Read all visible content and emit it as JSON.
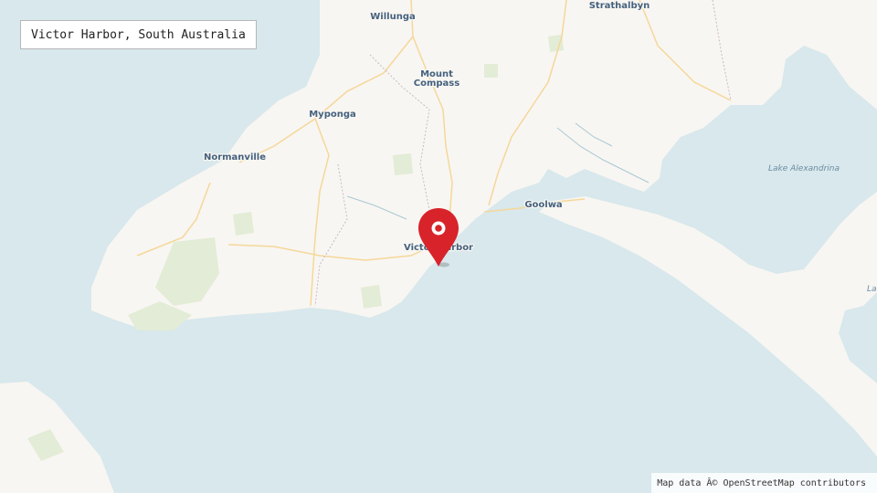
{
  "map": {
    "title": "Victor Harbor, South Australia",
    "attribution": "Map data Â© OpenStreetMap contributors",
    "marker": {
      "label": "Victor Harbor",
      "icon": "map-pin-icon",
      "color": "#d8232a"
    },
    "places": [
      {
        "id": "willunga",
        "name": "Willunga"
      },
      {
        "id": "strathalbyn",
        "name": "Strathalbyn"
      },
      {
        "id": "mount-compass-1",
        "name": "Mount"
      },
      {
        "id": "mount-compass-2",
        "name": "Compass"
      },
      {
        "id": "myponga",
        "name": "Myponga"
      },
      {
        "id": "normanville",
        "name": "Normanville"
      },
      {
        "id": "goolwa",
        "name": "Goolwa"
      },
      {
        "id": "victor-harbor",
        "name": "Victor Harbor"
      }
    ],
    "water_labels": [
      {
        "id": "lake-alexandrina",
        "name": "Lake Alexandrina"
      },
      {
        "id": "lake-partial",
        "name": "La"
      }
    ],
    "colors": {
      "water": "#d8e8ec",
      "land": "#f8f6f2",
      "park": "#e3ecd6",
      "road": "#f5d79a",
      "boundary": "#c9b8c9",
      "label": "#45617e"
    }
  }
}
